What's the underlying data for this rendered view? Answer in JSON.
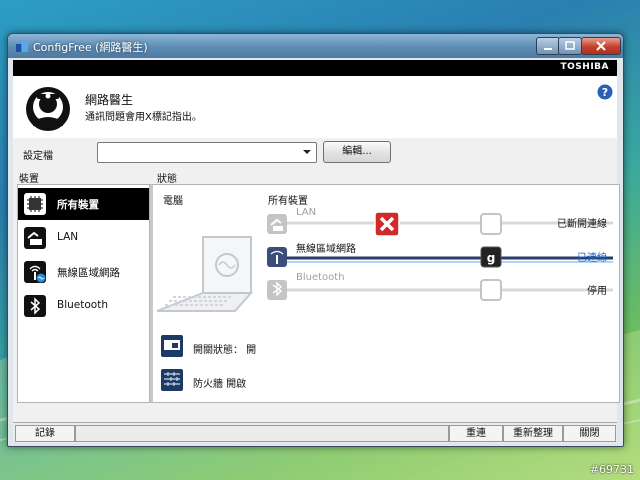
{
  "window": {
    "title": "ConfigFree (網路醫生)"
  },
  "brand": "TOSHIBA",
  "header": {
    "title": "網路醫生",
    "subtitle": "通訊問題會用X標記指出。"
  },
  "profile": {
    "label": "設定檔",
    "value": "",
    "edit_label": "編輯..."
  },
  "columns": {
    "devices": "裝置",
    "status": "狀態"
  },
  "devices": [
    {
      "label": "所有裝置",
      "icon": "chip-icon"
    },
    {
      "label": "LAN",
      "icon": "lan-cable-icon"
    },
    {
      "label": "無線區域網路",
      "icon": "wireless-icon"
    },
    {
      "label": "Bluetooth",
      "icon": "bluetooth-icon"
    }
  ],
  "status": {
    "computer_label": "電腦",
    "all_devices_label": "所有裝置",
    "rows": [
      {
        "name": "LAN",
        "status": "已斷開連線",
        "badge": "x-mark"
      },
      {
        "name": "無線區域網路",
        "status": "已連線",
        "badge": "g"
      },
      {
        "name": "Bluetooth",
        "status": "停用",
        "badge": ""
      }
    ],
    "switch_label": "開關狀態： 開",
    "firewall_label": "防火牆 開啟"
  },
  "statusbar": {
    "log": "記錄",
    "reconnect": "重連",
    "refresh": "重新整理",
    "close": "關閉"
  },
  "watermark": "#69731",
  "colors": {
    "accent": "#1a63c9",
    "error": "#d22a2a",
    "title_gradient": "#5c8cb3"
  }
}
